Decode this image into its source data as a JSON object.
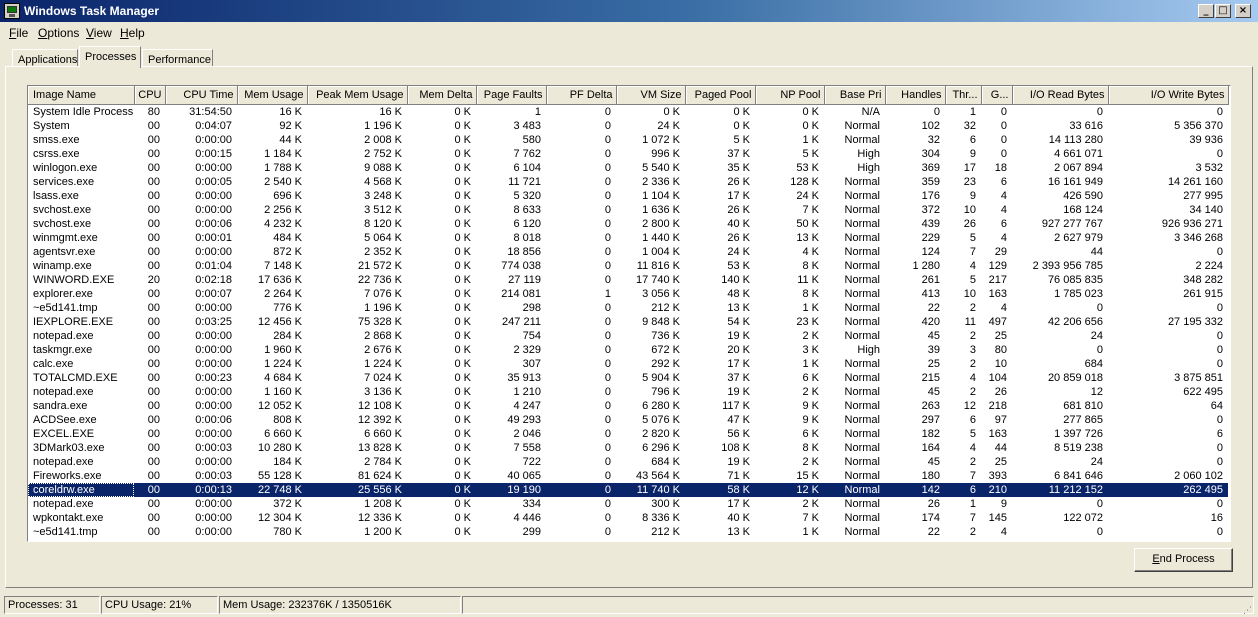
{
  "window": {
    "title": "Windows Task Manager",
    "icon": "task-manager-icon",
    "controls": {
      "minimize": "_",
      "maximize": "□",
      "close": "×"
    }
  },
  "menu": [
    {
      "first": "F",
      "rest": "ile"
    },
    {
      "first": "O",
      "rest": "ptions"
    },
    {
      "first": "V",
      "rest": "iew"
    },
    {
      "first": "H",
      "rest": "elp"
    }
  ],
  "tabs": [
    {
      "label": "Applications",
      "active": false
    },
    {
      "label": "Processes",
      "active": true
    },
    {
      "label": "Performance",
      "active": false
    }
  ],
  "columns": [
    "Image Name",
    "CPU",
    "CPU Time",
    "Mem Usage",
    "Peak Mem Usage",
    "Mem Delta",
    "Page Faults",
    "PF Delta",
    "VM Size",
    "Paged Pool",
    "NP Pool",
    "Base Pri",
    "Handles",
    "Thr...",
    "G...",
    "I/O Read Bytes",
    "I/O Write Bytes"
  ],
  "processes": [
    [
      "System Idle Process",
      "80",
      "31:54:50",
      "16 K",
      "16 K",
      "0 K",
      "1",
      "0",
      "0 K",
      "0 K",
      "0 K",
      "N/A",
      "0",
      "1",
      "0",
      "0",
      "0"
    ],
    [
      "System",
      "00",
      "0:04:07",
      "92 K",
      "1 196 K",
      "0 K",
      "3 483",
      "0",
      "24 K",
      "0 K",
      "0 K",
      "Normal",
      "102",
      "32",
      "0",
      "33 616",
      "5 356 370"
    ],
    [
      "smss.exe",
      "00",
      "0:00:00",
      "44 K",
      "2 008 K",
      "0 K",
      "580",
      "0",
      "1 072 K",
      "5 K",
      "1 K",
      "Normal",
      "32",
      "6",
      "0",
      "14 113 280",
      "39 936"
    ],
    [
      "csrss.exe",
      "00",
      "0:00:15",
      "1 184 K",
      "2 752 K",
      "0 K",
      "7 762",
      "0",
      "996 K",
      "37 K",
      "5 K",
      "High",
      "304",
      "9",
      "0",
      "4 661 071",
      "0"
    ],
    [
      "winlogon.exe",
      "00",
      "0:00:00",
      "1 788 K",
      "9 088 K",
      "0 K",
      "6 104",
      "0",
      "5 540 K",
      "35 K",
      "53 K",
      "High",
      "369",
      "17",
      "18",
      "2 067 894",
      "3 532"
    ],
    [
      "services.exe",
      "00",
      "0:00:05",
      "2 540 K",
      "4 568 K",
      "0 K",
      "11 721",
      "0",
      "2 336 K",
      "26 K",
      "128 K",
      "Normal",
      "359",
      "23",
      "6",
      "16 161 949",
      "14 261 160"
    ],
    [
      "lsass.exe",
      "00",
      "0:00:00",
      "696 K",
      "3 248 K",
      "0 K",
      "5 320",
      "0",
      "1 104 K",
      "17 K",
      "24 K",
      "Normal",
      "176",
      "9",
      "4",
      "426 590",
      "277 995"
    ],
    [
      "svchost.exe",
      "00",
      "0:00:00",
      "2 256 K",
      "3 512 K",
      "0 K",
      "8 633",
      "0",
      "1 636 K",
      "26 K",
      "7 K",
      "Normal",
      "372",
      "10",
      "4",
      "168 124",
      "34 140"
    ],
    [
      "svchost.exe",
      "00",
      "0:00:06",
      "4 232 K",
      "8 120 K",
      "0 K",
      "6 120",
      "0",
      "2 800 K",
      "40 K",
      "50 K",
      "Normal",
      "439",
      "26",
      "6",
      "927 277 767",
      "926 936 271"
    ],
    [
      "winmgmt.exe",
      "00",
      "0:00:01",
      "484 K",
      "5 064 K",
      "0 K",
      "8 018",
      "0",
      "1 440 K",
      "26 K",
      "13 K",
      "Normal",
      "229",
      "5",
      "4",
      "2 627 979",
      "3 346 268"
    ],
    [
      "agentsvr.exe",
      "00",
      "0:00:00",
      "872 K",
      "2 352 K",
      "0 K",
      "18 856",
      "0",
      "1 004 K",
      "24 K",
      "4 K",
      "Normal",
      "124",
      "7",
      "29",
      "44",
      "0"
    ],
    [
      "winamp.exe",
      "00",
      "0:01:04",
      "7 148 K",
      "21 572 K",
      "0 K",
      "774 038",
      "0",
      "11 816 K",
      "53 K",
      "8 K",
      "Normal",
      "1 280",
      "4",
      "129",
      "2 393 956 785",
      "2 224"
    ],
    [
      "WINWORD.EXE",
      "20",
      "0:02:18",
      "17 636 K",
      "22 736 K",
      "0 K",
      "27 119",
      "0",
      "17 740 K",
      "140 K",
      "11 K",
      "Normal",
      "261",
      "5",
      "217",
      "76 085 835",
      "348 282"
    ],
    [
      "explorer.exe",
      "00",
      "0:00:07",
      "2 264 K",
      "7 076 K",
      "0 K",
      "214 081",
      "1",
      "3 056 K",
      "48 K",
      "8 K",
      "Normal",
      "413",
      "10",
      "163",
      "1 785 023",
      "261 915"
    ],
    [
      "~e5d141.tmp",
      "00",
      "0:00:00",
      "776 K",
      "1 196 K",
      "0 K",
      "298",
      "0",
      "212 K",
      "13 K",
      "1 K",
      "Normal",
      "22",
      "2",
      "4",
      "0",
      "0"
    ],
    [
      "IEXPLORE.EXE",
      "00",
      "0:03:25",
      "12 456 K",
      "75 328 K",
      "0 K",
      "247 211",
      "0",
      "9 848 K",
      "54 K",
      "23 K",
      "Normal",
      "420",
      "11",
      "497",
      "42 206 656",
      "27 195 332"
    ],
    [
      "notepad.exe",
      "00",
      "0:00:00",
      "284 K",
      "2 868 K",
      "0 K",
      "754",
      "0",
      "736 K",
      "19 K",
      "2 K",
      "Normal",
      "45",
      "2",
      "25",
      "24",
      "0"
    ],
    [
      "taskmgr.exe",
      "00",
      "0:00:00",
      "1 960 K",
      "2 676 K",
      "0 K",
      "2 329",
      "0",
      "672 K",
      "20 K",
      "3 K",
      "High",
      "39",
      "3",
      "80",
      "0",
      "0"
    ],
    [
      "calc.exe",
      "00",
      "0:00:00",
      "1 224 K",
      "1 224 K",
      "0 K",
      "307",
      "0",
      "292 K",
      "17 K",
      "1 K",
      "Normal",
      "25",
      "2",
      "10",
      "684",
      "0"
    ],
    [
      "TOTALCMD.EXE",
      "00",
      "0:00:23",
      "4 684 K",
      "7 024 K",
      "0 K",
      "35 913",
      "0",
      "5 904 K",
      "37 K",
      "6 K",
      "Normal",
      "215",
      "4",
      "104",
      "20 859 018",
      "3 875 851"
    ],
    [
      "notepad.exe",
      "00",
      "0:00:00",
      "1 160 K",
      "3 136 K",
      "0 K",
      "1 210",
      "0",
      "796 K",
      "19 K",
      "2 K",
      "Normal",
      "45",
      "2",
      "26",
      "12",
      "622 495"
    ],
    [
      "sandra.exe",
      "00",
      "0:00:00",
      "12 052 K",
      "12 108 K",
      "0 K",
      "4 247",
      "0",
      "6 280 K",
      "117 K",
      "9 K",
      "Normal",
      "263",
      "12",
      "218",
      "681 810",
      "64"
    ],
    [
      "ACDSee.exe",
      "00",
      "0:00:06",
      "808 K",
      "12 392 K",
      "0 K",
      "49 293",
      "0",
      "5 076 K",
      "47 K",
      "9 K",
      "Normal",
      "297",
      "6",
      "97",
      "277 865",
      "0"
    ],
    [
      "EXCEL.EXE",
      "00",
      "0:00:00",
      "6 660 K",
      "6 660 K",
      "0 K",
      "2 046",
      "0",
      "2 820 K",
      "56 K",
      "6 K",
      "Normal",
      "182",
      "5",
      "163",
      "1 397 726",
      "6"
    ],
    [
      "3DMark03.exe",
      "00",
      "0:00:03",
      "10 280 K",
      "13 828 K",
      "0 K",
      "7 558",
      "0",
      "6 296 K",
      "108 K",
      "8 K",
      "Normal",
      "164",
      "4",
      "44",
      "8 519 238",
      "0"
    ],
    [
      "notepad.exe",
      "00",
      "0:00:00",
      "184 K",
      "2 784 K",
      "0 K",
      "722",
      "0",
      "684 K",
      "19 K",
      "2 K",
      "Normal",
      "45",
      "2",
      "25",
      "24",
      "0"
    ],
    [
      "Fireworks.exe",
      "00",
      "0:00:03",
      "55 128 K",
      "81 624 K",
      "0 K",
      "40 065",
      "0",
      "43 564 K",
      "71 K",
      "15 K",
      "Normal",
      "180",
      "7",
      "393",
      "6 841 646",
      "2 060 102"
    ],
    [
      "coreldrw.exe",
      "00",
      "0:00:13",
      "22 748 K",
      "25 556 K",
      "0 K",
      "19 190",
      "0",
      "11 740 K",
      "58 K",
      "12 K",
      "Normal",
      "142",
      "6",
      "210",
      "11 212 152",
      "262 495"
    ],
    [
      "notepad.exe",
      "00",
      "0:00:00",
      "372 K",
      "1 208 K",
      "0 K",
      "334",
      "0",
      "300 K",
      "17 K",
      "2 K",
      "Normal",
      "26",
      "1",
      "9",
      "0",
      "0"
    ],
    [
      "wpkontakt.exe",
      "00",
      "0:00:00",
      "12 304 K",
      "12 336 K",
      "0 K",
      "4 446",
      "0",
      "8 336 K",
      "40 K",
      "7 K",
      "Normal",
      "174",
      "7",
      "145",
      "122 072",
      "16"
    ],
    [
      "~e5d141.tmp",
      "00",
      "0:00:00",
      "780 K",
      "1 200 K",
      "0 K",
      "299",
      "0",
      "212 K",
      "13 K",
      "1 K",
      "Normal",
      "22",
      "2",
      "4",
      "0",
      "0"
    ]
  ],
  "selected_process": "coreldrw.exe",
  "end_process": {
    "first": "E",
    "rest": "nd Process"
  },
  "status": {
    "processes": "Processes: 31",
    "cpu": "CPU Usage: 21%",
    "mem": "Mem Usage: 232376K / 1350516K"
  },
  "colors": {
    "selection": "#0a246a",
    "title_start": "#0a246a",
    "title_end": "#a6caf0",
    "face": "#ece9d8"
  }
}
